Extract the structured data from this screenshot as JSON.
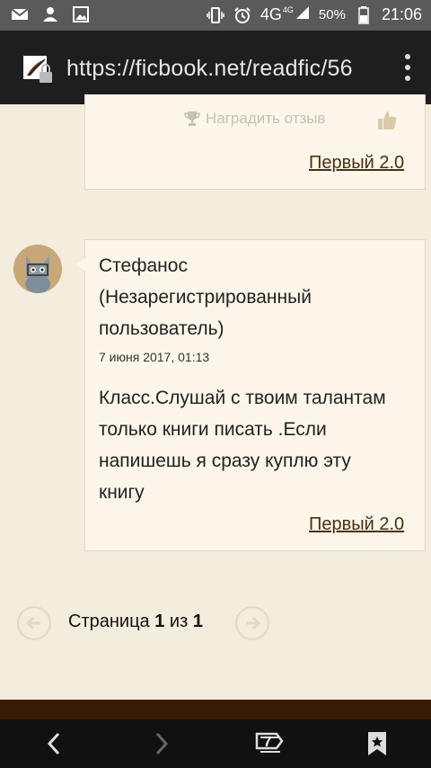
{
  "status_bar": {
    "network": "4G",
    "network_small": "4G",
    "battery": "50%",
    "time": "21:06"
  },
  "browser": {
    "url": "https://ficbook.net/readfic/56",
    "tab_count": "7"
  },
  "previous_card": {
    "reward_label": "Наградить отзыв",
    "link": "Первый 2.0"
  },
  "comment": {
    "author_lines": [
      "Стефанос",
      "(Незарегистрированный",
      "пользователь)"
    ],
    "date": "7 июня 2017, 01:13",
    "text_lines": [
      "Класс.Слушай с твоим талантам",
      "только книги писать .Если",
      "напишешь я сразу куплю эту",
      "книгу"
    ],
    "link": "Первый 2.0"
  },
  "pager": {
    "prefix": "Страница",
    "current": "1",
    "separator": "из",
    "total": "1"
  },
  "colors": {
    "page_bg": "#f4ecdc",
    "card_bg": "#fdf6ea",
    "link": "#4a3010",
    "footer_band": "#3a1c06"
  }
}
